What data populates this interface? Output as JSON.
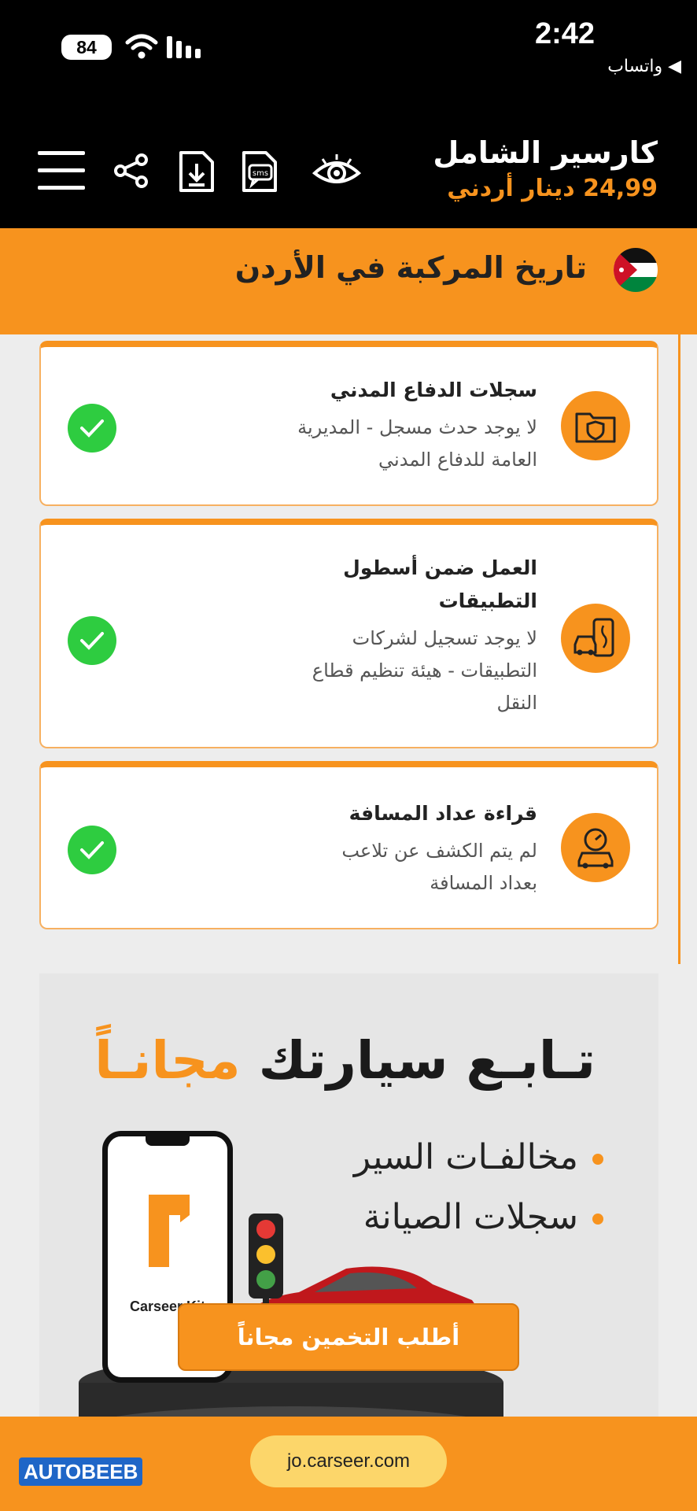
{
  "status_bar": {
    "battery": "84",
    "time": "2:42",
    "back_app": "◀ واتساب"
  },
  "header": {
    "title": "كارسير الشامل",
    "price": "24,99 دينار أردني",
    "icons": [
      "eye-icon",
      "sms-icon",
      "download-report-icon",
      "share-icon",
      "menu-icon"
    ]
  },
  "banner": {
    "title": "تاريخ المركبة في الأردن",
    "flag": "jordan-flag"
  },
  "cards": [
    {
      "title": "سجلات الدفاع المدني",
      "desc_lines": [
        "لا يوجد حدث مسجل - المديرية",
        "العامة للدفاع المدني"
      ],
      "icon": "folder-shield-icon"
    },
    {
      "title_lines": [
        "العمل ضمن أسطول",
        "التطبيقات"
      ],
      "desc_lines": [
        "لا يوجد تسجيل لشركات",
        "التطبيقات - هيئة تنظيم قطاع",
        "النقل"
      ],
      "icon": "car-app-icon"
    },
    {
      "title": "قراءة عداد المسافة",
      "desc_lines": [
        "لم يتم الكشف عن تلاعب",
        "بعداد المسافة"
      ],
      "icon": "odometer-car-icon"
    }
  ],
  "ad": {
    "headline_part1": "تـابـع سيارتك",
    "headline_part2": "مجانـاً",
    "bullets": [
      "مخالفـات السير",
      "سجلات الصيانة"
    ],
    "phone_label": "Carseer Kit"
  },
  "cta": "أطلب التخمين مجاناً",
  "footer": {
    "url": "jo.carseer.com",
    "watermark": "AUTOBEEB"
  },
  "colors": {
    "accent": "#f7931e",
    "success": "#2ecc40",
    "header_bg": "#000000"
  }
}
